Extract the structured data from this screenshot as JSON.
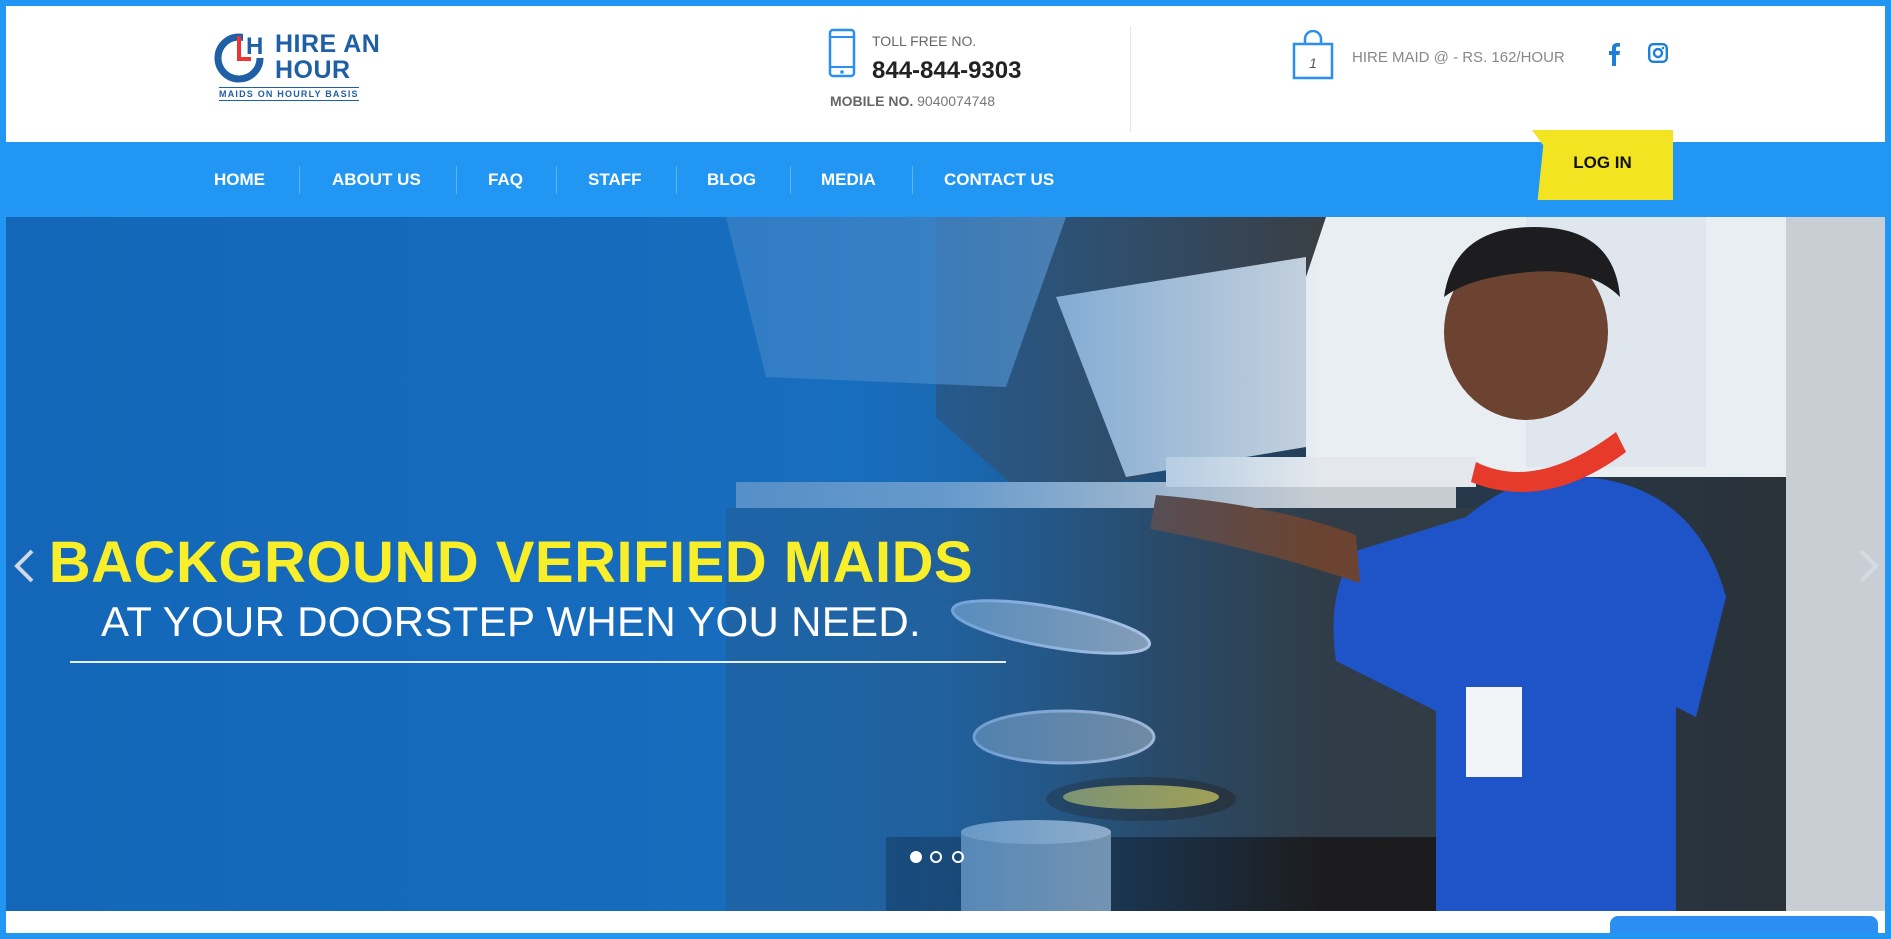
{
  "brand": {
    "line1": "HIRE AN",
    "line2": "HOUR",
    "tagline": "MAIDS ON HOURLY BASIS",
    "color": "#1f5fa6"
  },
  "contact": {
    "toll_free_label": "TOLL FREE NO.",
    "toll_free_number": "844-844-9303",
    "mobile_label": "MOBILE NO.",
    "mobile_number": "9040074748"
  },
  "cart": {
    "count": "1",
    "icon": "shopping-bag-icon"
  },
  "promo": {
    "text": "HIRE MAID @ - RS. 162/HOUR"
  },
  "social": [
    {
      "name": "facebook-icon"
    },
    {
      "name": "instagram-icon"
    }
  ],
  "nav": {
    "items": [
      {
        "label": "HOME"
      },
      {
        "label": "ABOUT US"
      },
      {
        "label": "FAQ"
      },
      {
        "label": "STAFF"
      },
      {
        "label": "BLOG"
      },
      {
        "label": "MEDIA"
      },
      {
        "label": "CONTACT US"
      }
    ],
    "login_label": "LOG IN"
  },
  "hero": {
    "title": "BACKGROUND VERIFIED MAIDS",
    "subtitle": "AT YOUR DOORSTEP WHEN YOU NEED.",
    "slides_total": 3,
    "active_slide": 1
  },
  "colors": {
    "primary": "#2196f3",
    "accent_yellow": "#f3e421",
    "hero_title": "#f8ee2a"
  }
}
